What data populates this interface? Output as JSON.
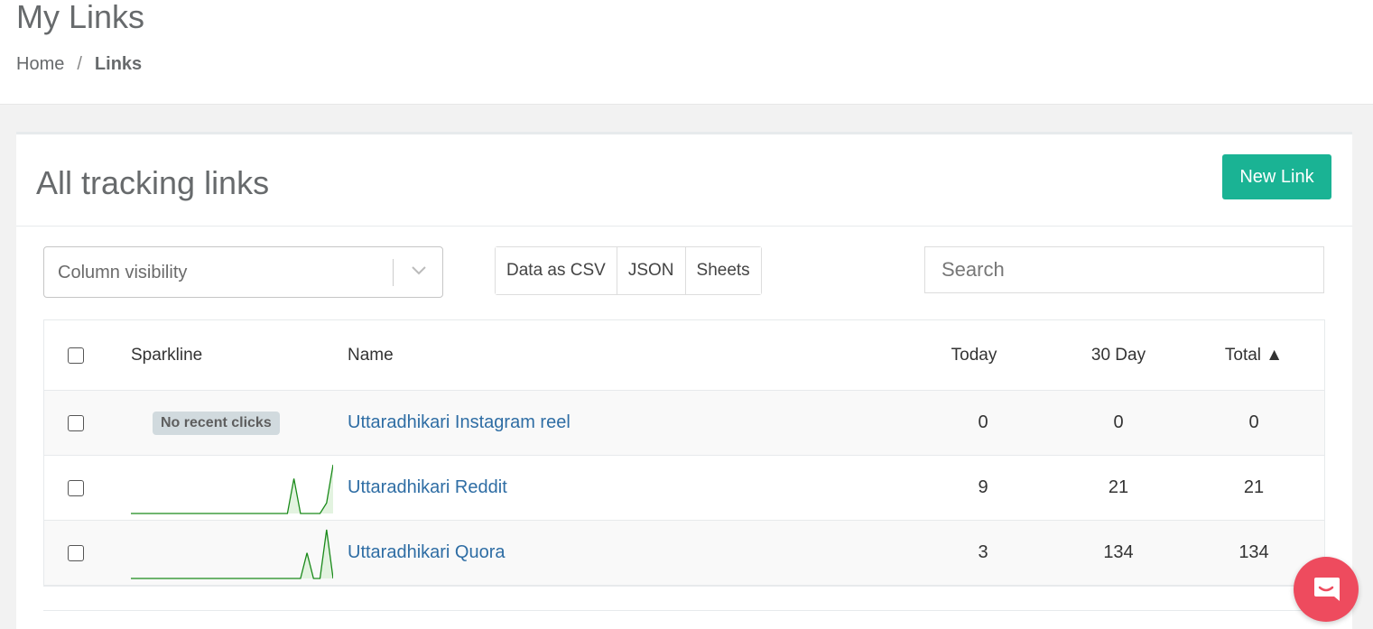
{
  "header": {
    "title": "My Links",
    "breadcrumb": {
      "home": "Home",
      "separator": "/",
      "current": "Links"
    }
  },
  "card": {
    "title": "All tracking links",
    "new_link_label": "New Link"
  },
  "toolbar": {
    "column_visibility_placeholder": "Column visibility",
    "export_buttons": [
      "Data as CSV",
      "JSON",
      "Sheets"
    ],
    "search_placeholder": "Search"
  },
  "table": {
    "columns": {
      "sparkline": "Sparkline",
      "name": "Name",
      "today": "Today",
      "thirty_day": "30 Day",
      "total": "Total ▲"
    },
    "rows": [
      {
        "name": "Uttaradhikari Instagram reel",
        "today": "0",
        "thirty_day": "0",
        "total": "0",
        "sparkline_badge": "No recent clicks",
        "spark": []
      },
      {
        "name": "Uttaradhikari Reddit",
        "today": "9",
        "thirty_day": "21",
        "total": "21",
        "spark": [
          0,
          0,
          0,
          0,
          0,
          0,
          0,
          0,
          0,
          0,
          0,
          0,
          0,
          0,
          0,
          0,
          0,
          0,
          0,
          0,
          0,
          0,
          0,
          0,
          0,
          10,
          0,
          0,
          0,
          0,
          3,
          14
        ]
      },
      {
        "name": "Uttaradhikari Quora",
        "today": "3",
        "thirty_day": "134",
        "total": "134",
        "spark": [
          0,
          0,
          0,
          0,
          0,
          0,
          0,
          0,
          0,
          0,
          0,
          0,
          0,
          0,
          0,
          0,
          0,
          0,
          0,
          0,
          0,
          0,
          0,
          0,
          0,
          0,
          0,
          55,
          0,
          0,
          105,
          0
        ]
      }
    ]
  },
  "colors": {
    "primary": "#1ab394",
    "link": "#2e6da4",
    "spark": "#1a8a1a",
    "spark_fill": "#e3f3e0",
    "chat": "#ee4b5e"
  },
  "icons": {
    "dropdown": "chevron-down-icon",
    "chat": "chat-icon"
  }
}
